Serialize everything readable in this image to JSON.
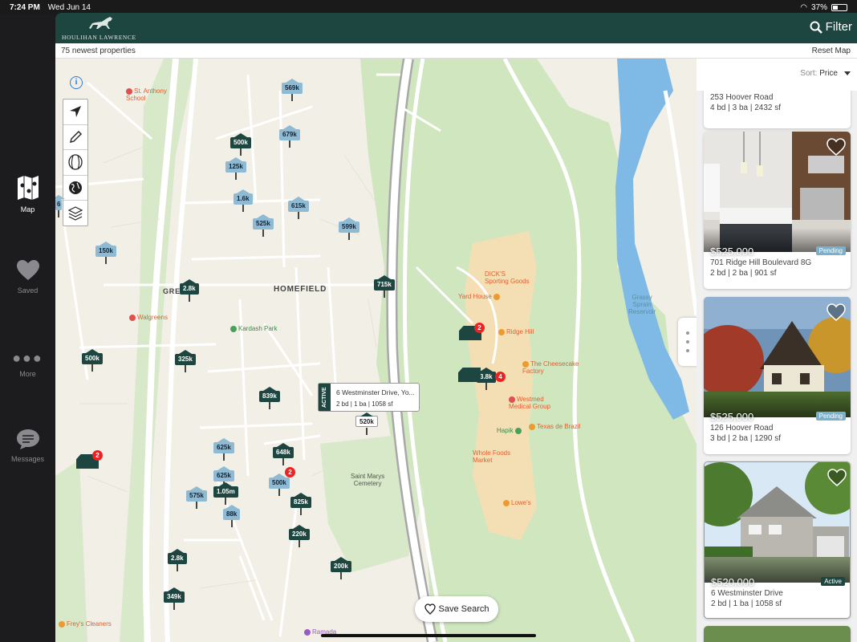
{
  "status": {
    "time": "7:24 PM",
    "date": "Wed Jun 14",
    "battery": "37%"
  },
  "sidebar": {
    "items": [
      {
        "label": "Map",
        "icon": "map-icon",
        "active": true
      },
      {
        "label": "Saved",
        "icon": "heart-icon",
        "active": false
      },
      {
        "label": "More",
        "icon": "more-dots-icon",
        "active": false
      },
      {
        "label": "Messages",
        "icon": "chat-bubble-icon",
        "active": false
      }
    ]
  },
  "header": {
    "brand": "HOULIHAN LAWRENCE",
    "filter_label": "Filter"
  },
  "subbar": {
    "count_text": "75 newest properties",
    "reset_label": "Reset Map"
  },
  "sort": {
    "label": "Sort:",
    "value": "Price"
  },
  "map": {
    "info_label": "i",
    "tools": [
      "navigation-arrow-icon",
      "draw-pencil-icon",
      "school-zone-icon",
      "globe-icon",
      "map-layers-icon"
    ],
    "places": [
      "HOMEFIELD",
      "GREENBURGH"
    ],
    "pins": [
      {
        "label": "569k",
        "style": "light"
      },
      {
        "label": "679k",
        "style": "light"
      },
      {
        "label": "500k",
        "style": "dark"
      },
      {
        "label": "125k",
        "style": "light"
      },
      {
        "label": "1.6k",
        "style": "light"
      },
      {
        "label": "615k",
        "style": "light"
      },
      {
        "label": "525k",
        "style": "light"
      },
      {
        "label": "599k",
        "style": "light"
      },
      {
        "label": "150k",
        "style": "light"
      },
      {
        "label": "2.8k",
        "style": "dark"
      },
      {
        "label": "715k",
        "style": "dark"
      },
      {
        "label": "500k",
        "style": "dark"
      },
      {
        "label": "325k",
        "style": "dark"
      },
      {
        "label": "839k",
        "style": "dark"
      },
      {
        "label": "520k",
        "style": "white"
      },
      {
        "label": "625k",
        "style": "light"
      },
      {
        "label": "648k",
        "style": "dark"
      },
      {
        "label": "625k",
        "style": "light"
      },
      {
        "label": "500k",
        "style": "light"
      },
      {
        "label": "575k",
        "style": "light"
      },
      {
        "label": "1.05m",
        "style": "dark"
      },
      {
        "label": "825k",
        "style": "dark"
      },
      {
        "label": "88k",
        "style": "light"
      },
      {
        "label": "220k",
        "style": "dark"
      },
      {
        "label": "2.8k",
        "style": "dark"
      },
      {
        "label": "200k",
        "style": "dark"
      },
      {
        "label": "349k",
        "style": "dark"
      },
      {
        "label": "3.8k",
        "style": "dark"
      },
      {
        "label": "6",
        "style": "light"
      }
    ],
    "cluster_badges": [
      "2",
      "2",
      "2",
      "4"
    ],
    "labels": {
      "st_anthony": "St. Anthony\nSchool",
      "walgreens": "Walgreens",
      "kardash": "Kardash Park",
      "dicks": "DICK'S\nSporting Goods",
      "yard_house": "Yard House",
      "ridge_hill": "Ridge Hill",
      "cheesecake": "The Cheesecake\nFactory",
      "westmed": "Westmed\nMedical Group",
      "hapik": "Hapik",
      "texas": "Texas de Brazil",
      "whole_foods": "Whole Foods\nMarket",
      "lowes": "Lowe's",
      "saint_marys": "Saint Marys\nCemetery",
      "grassy": "Grassy\nSprain\nReservoir",
      "freys": "Frey's Cleaners",
      "ramada": "Ramada",
      "hill": "Hill"
    },
    "popup": {
      "status": "ACTIVE",
      "address": "6 Westminster Drive, Yo...",
      "details": "2 bd | 1 ba | 1058 sf",
      "price_tag": "520k"
    },
    "save_search_label": "Save Search"
  },
  "listings": [
    {
      "price": "",
      "address": "253 Hoover Road",
      "details": "4 bd | 3 ba | 2432 sf",
      "status": ""
    },
    {
      "price": "$525,000",
      "address": "701 Ridge Hill Boulevard 8G",
      "details": "2 bd | 2 ba | 901 sf",
      "status": "Pending"
    },
    {
      "price": "$525,000",
      "address": "126 Hoover Road",
      "details": "3 bd | 2 ba | 1290 sf",
      "status": "Pending"
    },
    {
      "price": "$520,000",
      "address": "6 Westminster Drive",
      "details": "2 bd | 1 ba | 1058 sf",
      "status": "Active"
    }
  ],
  "colors": {
    "brand": "#1e4640",
    "pending": "#7ab0cc",
    "pin_light": "#8fbad4"
  }
}
